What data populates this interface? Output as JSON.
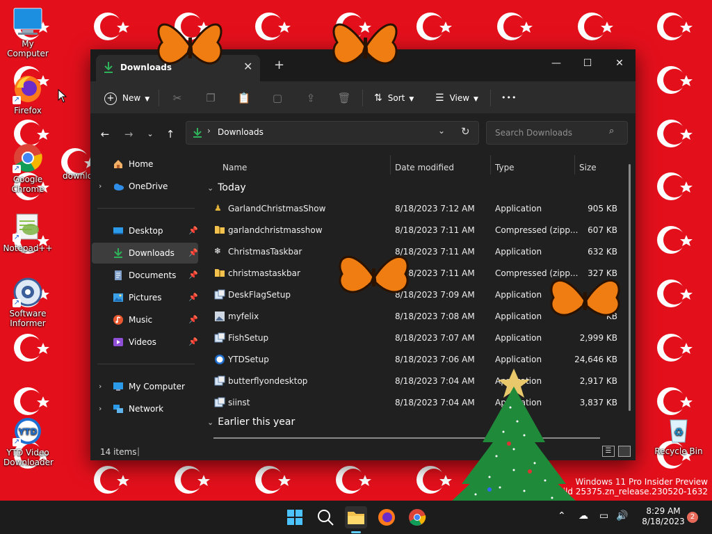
{
  "desktop": {
    "icons": [
      {
        "label": "My Computer"
      },
      {
        "label": "Firefox"
      },
      {
        "label": "Google Chrome"
      },
      {
        "label": "downlo"
      },
      {
        "label": "Notepad++"
      },
      {
        "label": "Software Informer"
      },
      {
        "label": "YTD Video Downloader"
      },
      {
        "label": "Recycle Bin"
      }
    ],
    "watermark": {
      "line1": "Windows 11 Pro Insider Preview",
      "line2": "Build 25375.zn_release.230520-1632"
    }
  },
  "window": {
    "tab_title": "Downloads",
    "toolbar": {
      "new_label": "New",
      "sort_label": "Sort",
      "view_label": "View",
      "more_label": "•••"
    },
    "address": {
      "path": "Downloads",
      "separator": "›"
    },
    "search": {
      "placeholder": "Search Downloads"
    },
    "sidebar": {
      "items": [
        {
          "label": "Home"
        },
        {
          "label": "OneDrive"
        },
        {
          "label": "Desktop"
        },
        {
          "label": "Downloads"
        },
        {
          "label": "Documents"
        },
        {
          "label": "Pictures"
        },
        {
          "label": "Music"
        },
        {
          "label": "Videos"
        },
        {
          "label": "My Computer"
        },
        {
          "label": "Network"
        }
      ]
    },
    "columns": {
      "name": "Name",
      "date": "Date modified",
      "type": "Type",
      "size": "Size"
    },
    "groups": {
      "today": "Today",
      "earlier": "Earlier this year"
    },
    "files": [
      {
        "name": "GarlandChristmasShow",
        "date": "8/18/2023 7:12 AM",
        "type": "Application",
        "size": "905 KB",
        "icon": "garland-icon"
      },
      {
        "name": "garlandchristmasshow",
        "date": "8/18/2023 7:11 AM",
        "type": "Compressed (zipp...",
        "size": "607 KB",
        "icon": "zip-folder-icon"
      },
      {
        "name": "ChristmasTaskbar",
        "date": "8/18/2023 7:11 AM",
        "type": "Application",
        "size": "632 KB",
        "icon": "snowflake-icon"
      },
      {
        "name": "christmastaskbar",
        "date": "8/18/2023 7:11 AM",
        "type": "Compressed (zipp...",
        "size": "327 KB",
        "icon": "zip-folder-icon"
      },
      {
        "name": "DeskFlagSetup",
        "date": "8/18/2023 7:09 AM",
        "type": "Application",
        "size": "B",
        "icon": "setup-icon"
      },
      {
        "name": "myfelix",
        "date": "8/18/2023 7:08 AM",
        "type": "Application",
        "size": "KB",
        "icon": "image-app-icon"
      },
      {
        "name": "FishSetup",
        "date": "8/18/2023 7:07 AM",
        "type": "Application",
        "size": "2,999 KB",
        "icon": "setup-icon"
      },
      {
        "name": "YTDSetup",
        "date": "8/18/2023 7:06 AM",
        "type": "Application",
        "size": "24,646 KB",
        "icon": "ytd-icon"
      },
      {
        "name": "butterflyondesktop",
        "date": "8/18/2023 7:04 AM",
        "type": "Application",
        "size": "2,917 KB",
        "icon": "setup-icon"
      },
      {
        "name": "siinst",
        "date": "8/18/2023 7:04 AM",
        "type": "Application",
        "size": "3,837 KB",
        "icon": "setup-icon"
      }
    ],
    "status": {
      "item_count": "14 items"
    }
  },
  "taskbar": {
    "time": "8:29 AM",
    "date": "8/18/2023",
    "notification_count": "2"
  },
  "colors": {
    "wallpaper_red": "#e3101c",
    "window_bg": "#202020",
    "accent_green": "#2fb35a",
    "folder_yellow": "#f2c14e"
  }
}
